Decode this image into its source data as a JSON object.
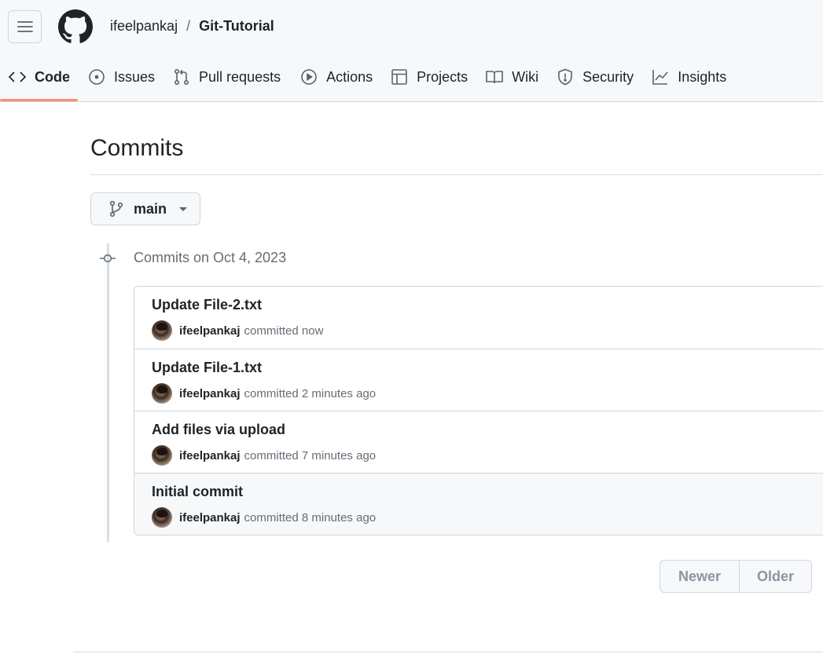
{
  "header": {
    "owner": "ifeelpankaj",
    "separator": "/",
    "repo": "Git-Tutorial"
  },
  "tabs": [
    {
      "label": "Code",
      "icon": "code-icon",
      "active": true
    },
    {
      "label": "Issues",
      "icon": "issue-opened-icon"
    },
    {
      "label": "Pull requests",
      "icon": "git-pull-request-icon"
    },
    {
      "label": "Actions",
      "icon": "play-icon"
    },
    {
      "label": "Projects",
      "icon": "table-icon"
    },
    {
      "label": "Wiki",
      "icon": "book-icon"
    },
    {
      "label": "Security",
      "icon": "shield-icon"
    },
    {
      "label": "Insights",
      "icon": "graph-icon"
    }
  ],
  "main": {
    "title": "Commits",
    "branch": "main",
    "group_heading": "Commits on Oct 4, 2023"
  },
  "commits": [
    {
      "title": "Update File-2.txt",
      "author": "ifeelpankaj",
      "meta": "committed now"
    },
    {
      "title": "Update File-1.txt",
      "author": "ifeelpankaj",
      "meta": "committed 2 minutes ago"
    },
    {
      "title": "Add files via upload",
      "author": "ifeelpankaj",
      "meta": "committed 7 minutes ago"
    },
    {
      "title": "Initial commit",
      "author": "ifeelpankaj",
      "meta": "committed 8 minutes ago"
    }
  ],
  "pagination": {
    "newer": "Newer",
    "older": "Older"
  },
  "colors": {
    "active_tab_underline": "#fd8c73",
    "border": "#d0d7de",
    "muted_text": "#656d76"
  }
}
